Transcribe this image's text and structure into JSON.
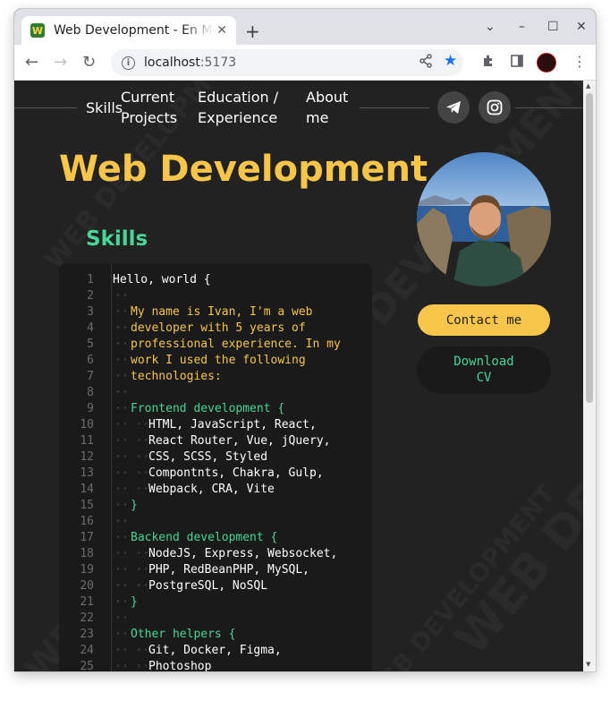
{
  "browser": {
    "tab_title": "Web Development - En Mode",
    "favicon_letter": "W",
    "tab_close": "✕",
    "new_tab": "+",
    "url_host": "localhost",
    "url_port": ":5173",
    "bookmarked": true
  },
  "page": {
    "nav": {
      "skills": "Skills",
      "current_projects": [
        "Current",
        "Projects"
      ],
      "education": [
        "Education /",
        "Experience"
      ],
      "about": [
        "About",
        "me"
      ]
    },
    "social": [
      "telegram-icon",
      "instagram-icon"
    ],
    "watermark": "WEB DEVELOPMENT",
    "title": "Web Development",
    "skills_heading": "Skills",
    "contact_button": "Contact me",
    "download_button": [
      "Download",
      "CV"
    ],
    "colors": {
      "accent_yellow": "#f7c54a",
      "accent_green": "#48d597",
      "background": "#222222",
      "code_bg": "#1a1a1a"
    }
  },
  "code": {
    "line_numbers": [
      "1",
      "2",
      "3",
      "4",
      "5",
      "6",
      "7",
      "8",
      "9",
      "10",
      "11",
      "12",
      "13",
      "14",
      "15",
      "16",
      "17",
      "18",
      "19",
      "20",
      "21",
      "22",
      "23",
      "24",
      "25"
    ],
    "lines": [
      {
        "text": "Hello, world {",
        "color": "#ffffff",
        "indent": 0
      },
      {
        "text": "",
        "color": "#ffffff",
        "indent": 1
      },
      {
        "text": "My name is Ivan, I'm a web",
        "color": "#f7c54a",
        "indent": 1
      },
      {
        "text": "developer with 5 years of",
        "color": "#f7c54a",
        "indent": 1
      },
      {
        "text": "professional experience. In my",
        "color": "#f7c54a",
        "indent": 1
      },
      {
        "text": "work I used the following",
        "color": "#f7c54a",
        "indent": 1
      },
      {
        "text": "technologies:",
        "color": "#f7c54a",
        "indent": 1
      },
      {
        "text": "",
        "color": "#ffffff",
        "indent": 1
      },
      {
        "text": "Frontend development {",
        "color": "#48d597",
        "indent": 1
      },
      {
        "text": "HTML, JavaScript, React,",
        "color": "#ffffff",
        "indent": 2
      },
      {
        "text": "React Router, Vue, jQuery,",
        "color": "#ffffff",
        "indent": 2
      },
      {
        "text": "CSS, SCSS, Styled",
        "color": "#ffffff",
        "indent": 2
      },
      {
        "text": "Compontnts, Chakra, Gulp,",
        "color": "#ffffff",
        "indent": 2
      },
      {
        "text": "Webpack, CRA, Vite",
        "color": "#ffffff",
        "indent": 2
      },
      {
        "text": "}",
        "color": "#48d597",
        "indent": 1
      },
      {
        "text": "",
        "color": "#ffffff",
        "indent": 1
      },
      {
        "text": "Backend development {",
        "color": "#48d597",
        "indent": 1
      },
      {
        "text": "NodeJS, Express, Websocket,",
        "color": "#ffffff",
        "indent": 2
      },
      {
        "text": "PHP, RedBeanPHP, MySQL,",
        "color": "#ffffff",
        "indent": 2
      },
      {
        "text": "PostgreSQL, NoSQL",
        "color": "#ffffff",
        "indent": 2
      },
      {
        "text": "}",
        "color": "#48d597",
        "indent": 1
      },
      {
        "text": "",
        "color": "#ffffff",
        "indent": 1
      },
      {
        "text": "Other helpers {",
        "color": "#48d597",
        "indent": 1
      },
      {
        "text": "Git, Docker, Figma,",
        "color": "#ffffff",
        "indent": 2
      },
      {
        "text": "Photoshop",
        "color": "#ffffff",
        "indent": 2
      }
    ]
  }
}
